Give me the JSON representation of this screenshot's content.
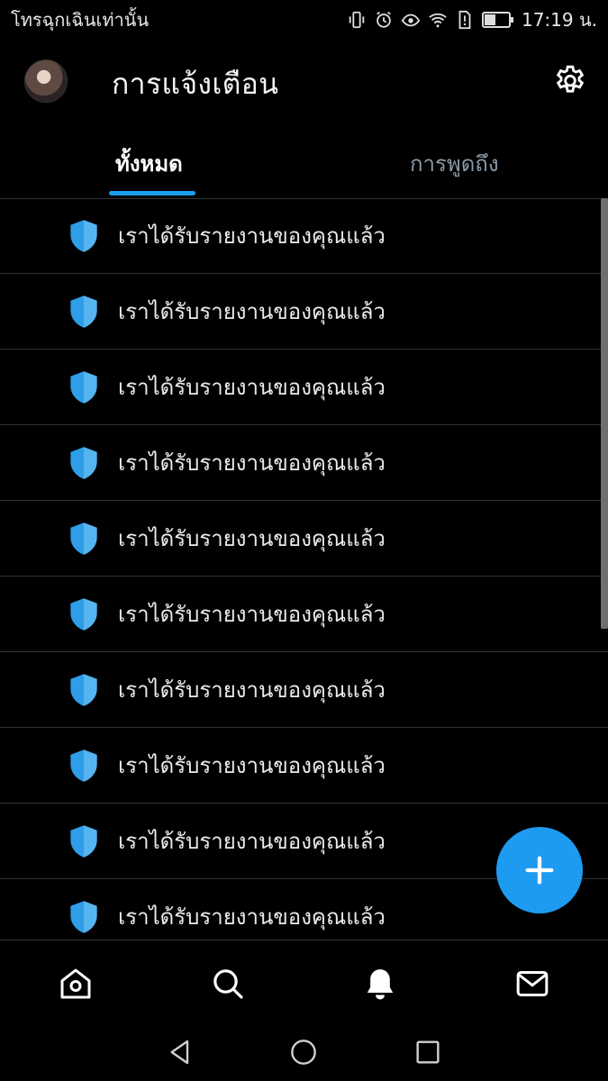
{
  "status_bar": {
    "carrier": "โทรฉุกเฉินเท่านั้น",
    "time": "17:19 น.",
    "icons": [
      "vibrate-icon",
      "alarm-icon",
      "eye-comfort-icon",
      "wifi-icon",
      "sim-alert-icon",
      "battery-icon"
    ]
  },
  "header": {
    "title": "การแจ้งเตือน",
    "settings_icon": "gear-icon"
  },
  "tabs": [
    {
      "label": "ทั้งหมด",
      "active": true
    },
    {
      "label": "การพูดถึง",
      "active": false
    }
  ],
  "notifications": [
    {
      "icon": "shield-icon",
      "text": "เราได้รับรายงานของคุณแล้ว"
    },
    {
      "icon": "shield-icon",
      "text": "เราได้รับรายงานของคุณแล้ว"
    },
    {
      "icon": "shield-icon",
      "text": "เราได้รับรายงานของคุณแล้ว"
    },
    {
      "icon": "shield-icon",
      "text": "เราได้รับรายงานของคุณแล้ว"
    },
    {
      "icon": "shield-icon",
      "text": "เราได้รับรายงานของคุณแล้ว"
    },
    {
      "icon": "shield-icon",
      "text": "เราได้รับรายงานของคุณแล้ว"
    },
    {
      "icon": "shield-icon",
      "text": "เราได้รับรายงานของคุณแล้ว"
    },
    {
      "icon": "shield-icon",
      "text": "เราได้รับรายงานของคุณแล้ว"
    },
    {
      "icon": "shield-icon",
      "text": "เราได้รับรายงานของคุณแล้ว"
    },
    {
      "icon": "shield-icon",
      "text": "เราได้รับรายงานของคุณแล้ว"
    }
  ],
  "fab_icon": "plus-icon",
  "bottom_nav": [
    "home-icon",
    "search-icon",
    "bell-icon",
    "mail-icon"
  ],
  "system_nav": [
    "back-icon",
    "home-circle-icon",
    "recents-icon"
  ],
  "colors": {
    "accent": "#1d9bf0",
    "background": "#000000",
    "divider": "#2f3336",
    "shield": "#2f9ee8"
  }
}
